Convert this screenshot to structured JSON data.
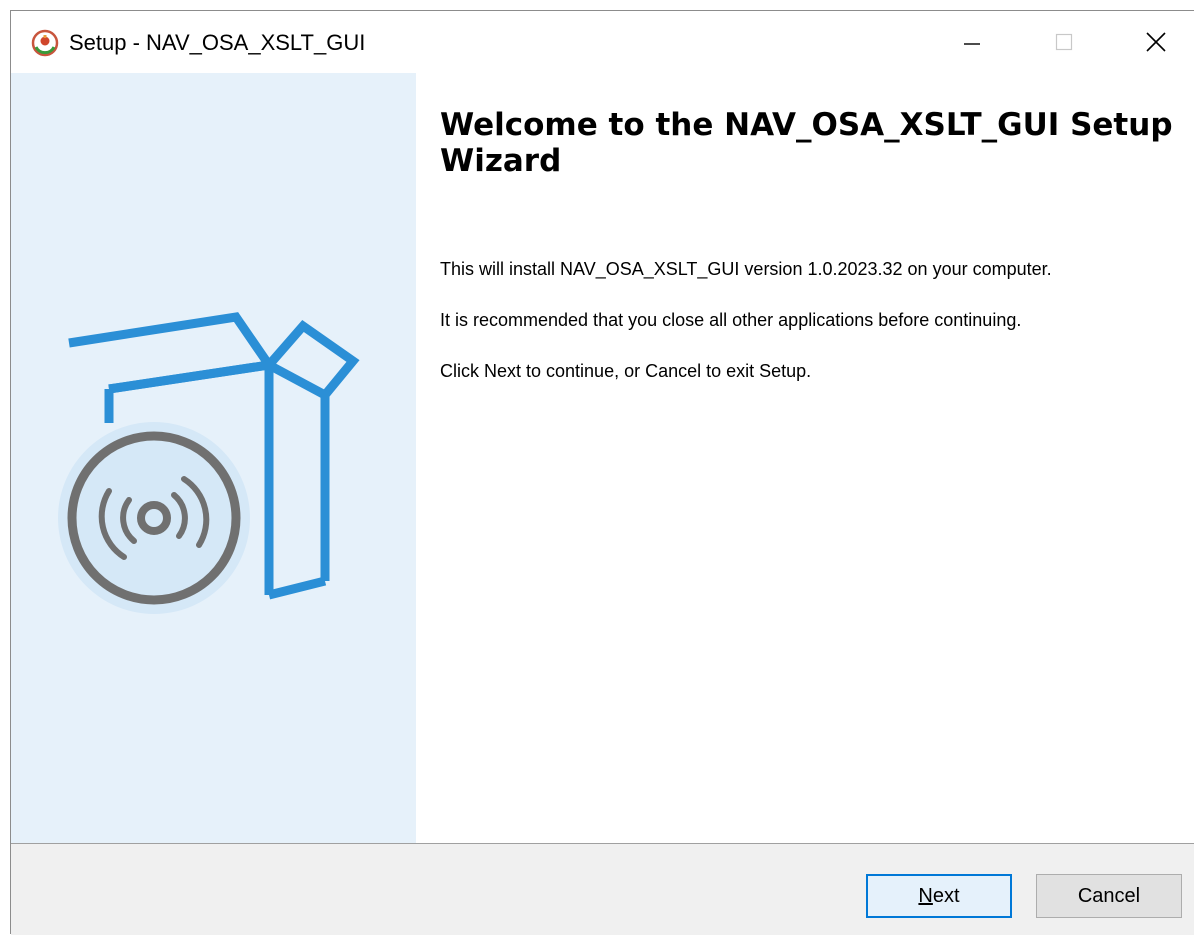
{
  "window": {
    "title": "Setup - NAV_OSA_XSLT_GUI",
    "icons": {
      "app": "installer-app-icon",
      "minimize": "minimize-icon",
      "maximize": "maximize-icon",
      "close": "close-icon"
    }
  },
  "sidebar": {
    "illustration": "box-with-disc-illustration",
    "colors": {
      "background": "#e6f1fa",
      "box_stroke": "#2b8fd6",
      "disc": "#707070"
    }
  },
  "content": {
    "heading": "Welcome to the NAV_OSA_XSLT_GUI Setup Wizard",
    "lines": [
      "This will install NAV_OSA_XSLT_GUI version 1.0.2023.32 on your computer.",
      "It is recommended that you close all other applications before continuing.",
      "Click Next to continue, or Cancel to exit Setup."
    ]
  },
  "footer": {
    "next": {
      "mnemonic": "N",
      "rest": "ext"
    },
    "cancel": "Cancel",
    "colors": {
      "default_button_border": "#0078d7"
    }
  }
}
